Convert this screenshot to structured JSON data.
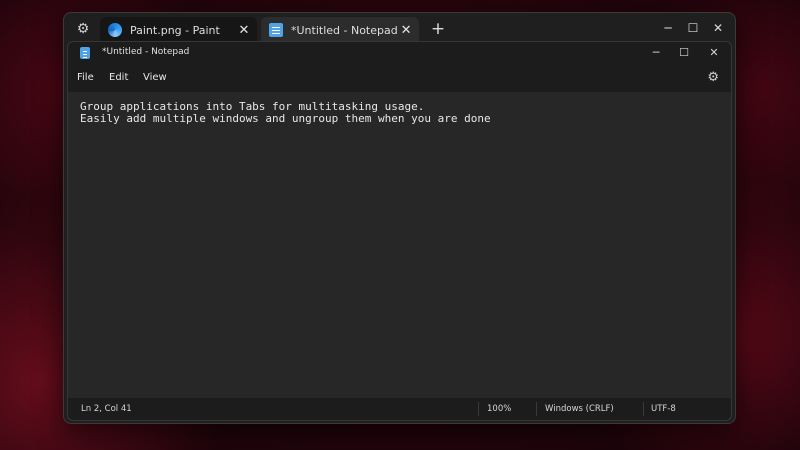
{
  "tabs": [
    {
      "label": "Paint.png - Paint",
      "icon": "paint-icon"
    },
    {
      "label": "*Untitled - Notepad",
      "icon": "notepad-icon"
    }
  ],
  "host_controls": {
    "minimize": "─",
    "maximize": "☐",
    "close": "✕"
  },
  "notepad": {
    "title": "*Untitled - Notepad",
    "menu": [
      "File",
      "Edit",
      "View"
    ],
    "content": "Group applications into Tabs for multitasking usage.\nEasily add multiple windows and ungroup them when you are done",
    "status": {
      "position": "Ln 2, Col 41",
      "zoom": "100%",
      "line_ending": "Windows (CRLF)",
      "encoding": "UTF-8"
    }
  },
  "accent_color": "#c4472f"
}
